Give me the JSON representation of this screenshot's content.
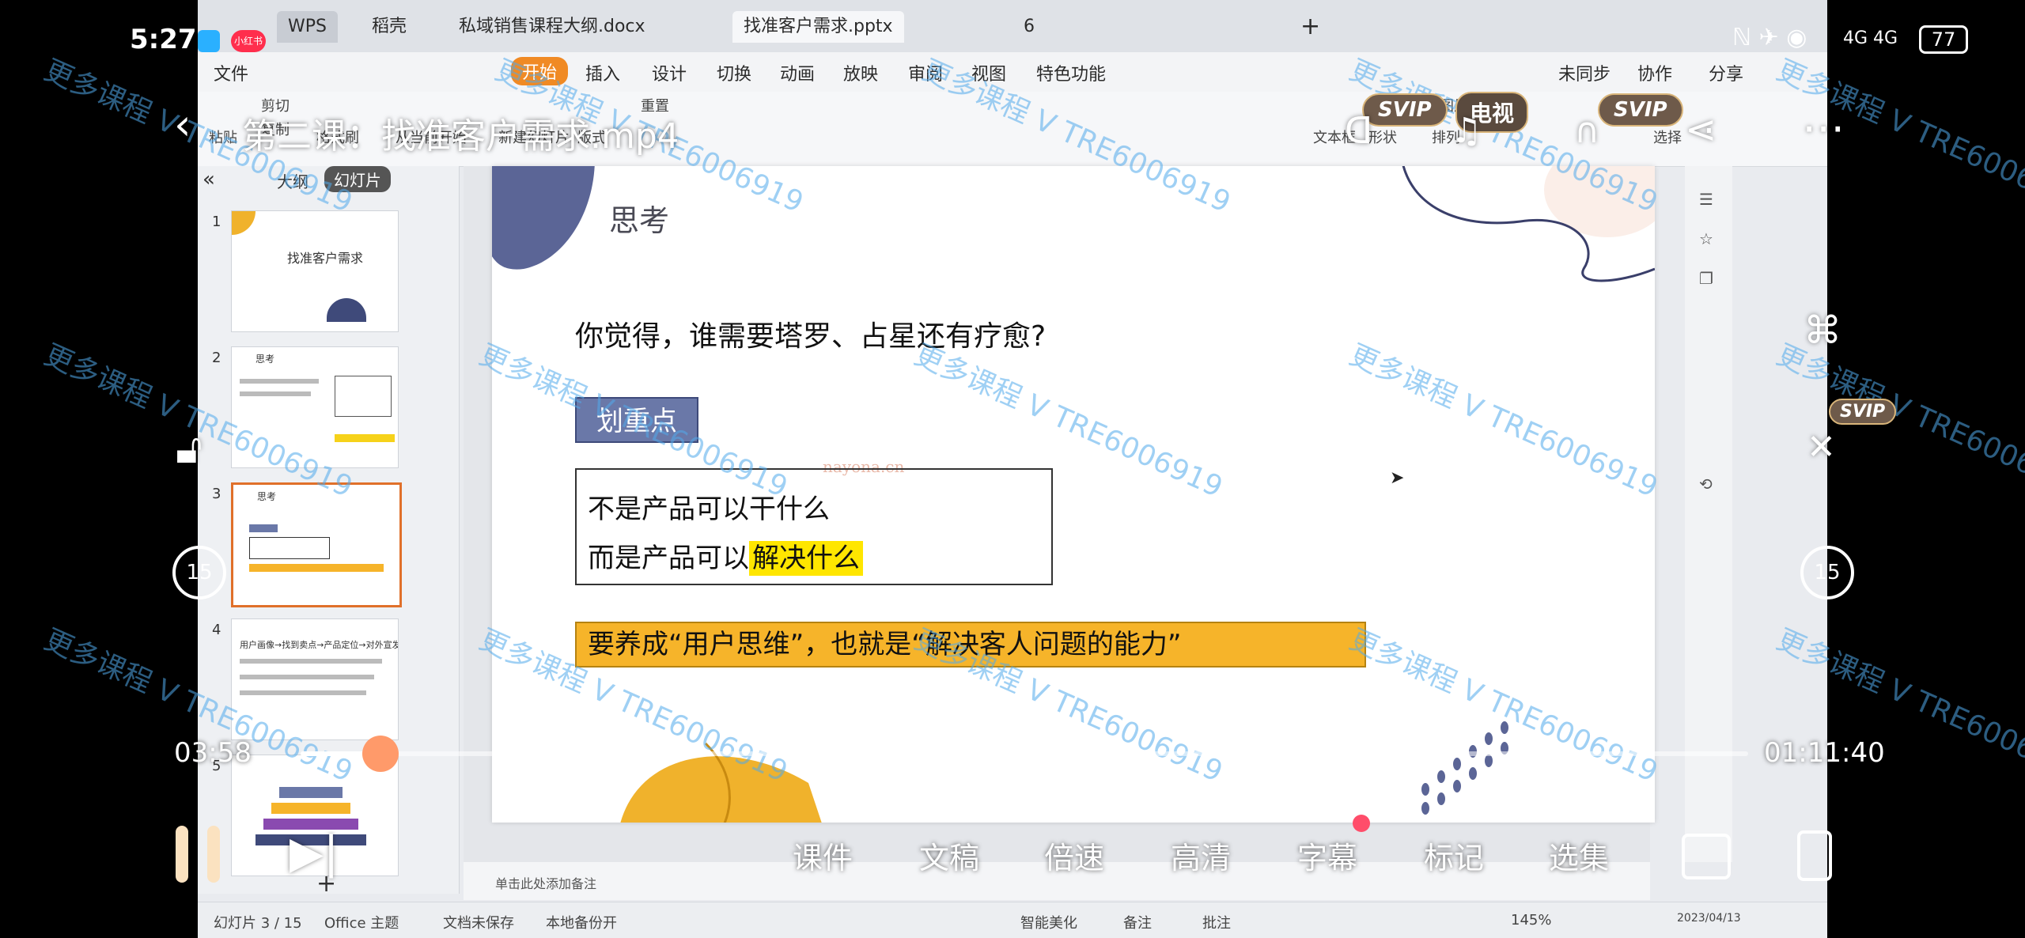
{
  "phone_status": {
    "time": "5:27",
    "app_badge": "小红书",
    "network": "4G 4G",
    "battery": "77"
  },
  "wps": {
    "tabs": [
      "WPS",
      "稻壳",
      "私域销售课程大纲.docx",
      "找准客户需求.pptx",
      "6"
    ],
    "menu": [
      "文件",
      "开始",
      "插入",
      "设计",
      "切换",
      "动画",
      "放映",
      "审阅",
      "视图",
      "特色功能"
    ],
    "menu_right": [
      "未同步",
      "协作",
      "分享"
    ],
    "toolbar": [
      "粘贴",
      "剪切",
      "复制",
      "格式刷",
      "从当前开始",
      "新建幻灯片",
      "版式",
      "重置",
      "文本框",
      "形状",
      "排列",
      "图片",
      "选择"
    ],
    "left_pane_tabs": [
      "大纲",
      "幻灯片"
    ],
    "thumbnails": [
      {
        "num": "1",
        "title": "找准客户需求"
      },
      {
        "num": "2",
        "title": "思考"
      },
      {
        "num": "3",
        "title": "思考"
      },
      {
        "num": "4",
        "title": "用户画像→找到卖点→产品定位→对外宣发"
      },
      {
        "num": "5",
        "title": ""
      }
    ],
    "slide": {
      "title": "思考",
      "question": "你觉得，谁需要塔罗、占星还有疗愈?",
      "tag": "划重点",
      "line1": "不是产品可以干什么",
      "line2_prefix": "而是产品可以",
      "line2_highlight": "解决什么",
      "banner": "要养成“用户思维”，也就是“解决客人问题的能力”",
      "source_watermark": "nayona.cn"
    },
    "notes_placeholder": "单击此处添加备注",
    "status": {
      "slide_pos": "幻灯片 3 / 15",
      "theme": "Office 主题",
      "doc_status": "文档未保存",
      "backup": "本地备份开",
      "beautify": "智能美化",
      "remarks": "备注",
      "comments": "批注",
      "zoom": "145%",
      "date": "2023/04/13"
    }
  },
  "player": {
    "video_title": "第二课：找准客户需求.mp4",
    "svip_label": "SVIP",
    "tv_label": "电视",
    "current_time": "03:58",
    "total_time": "01:11:40",
    "progress": 0.055,
    "skip_seconds": "15",
    "bottom_buttons": [
      "课件",
      "文稿",
      "倍速",
      "高清",
      "字幕",
      "标记",
      "选集"
    ]
  },
  "watermark_text": "更多课程 V TRE6006919"
}
